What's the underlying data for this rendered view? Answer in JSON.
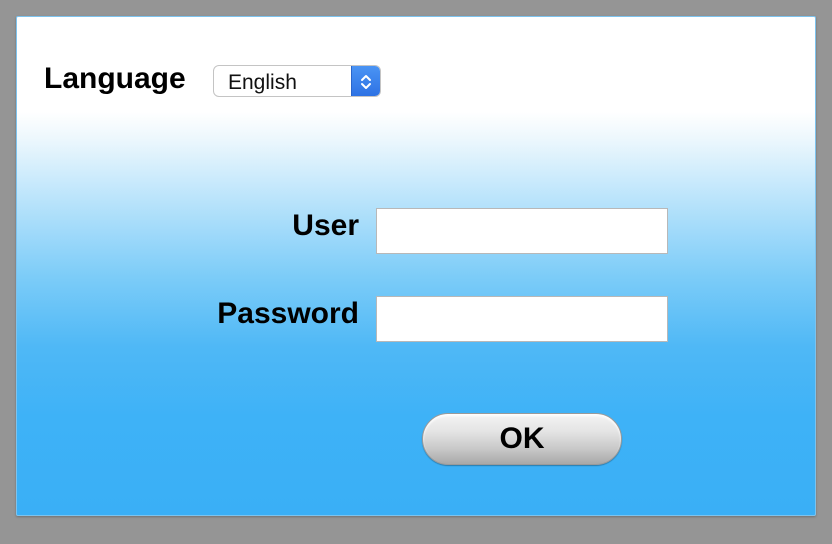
{
  "language": {
    "label": "Language",
    "selected": "English",
    "options": [
      "English"
    ]
  },
  "login": {
    "user_label": "User",
    "user_value": "",
    "password_label": "Password",
    "password_value": "",
    "ok_label": "OK"
  },
  "colors": {
    "page_background": "#959595",
    "panel_top": "#ffffff",
    "panel_bottom": "#3aaff6",
    "select_accent": "#2e72e4"
  },
  "icons": {
    "select_arrows": "chevron-up-down-icon"
  }
}
